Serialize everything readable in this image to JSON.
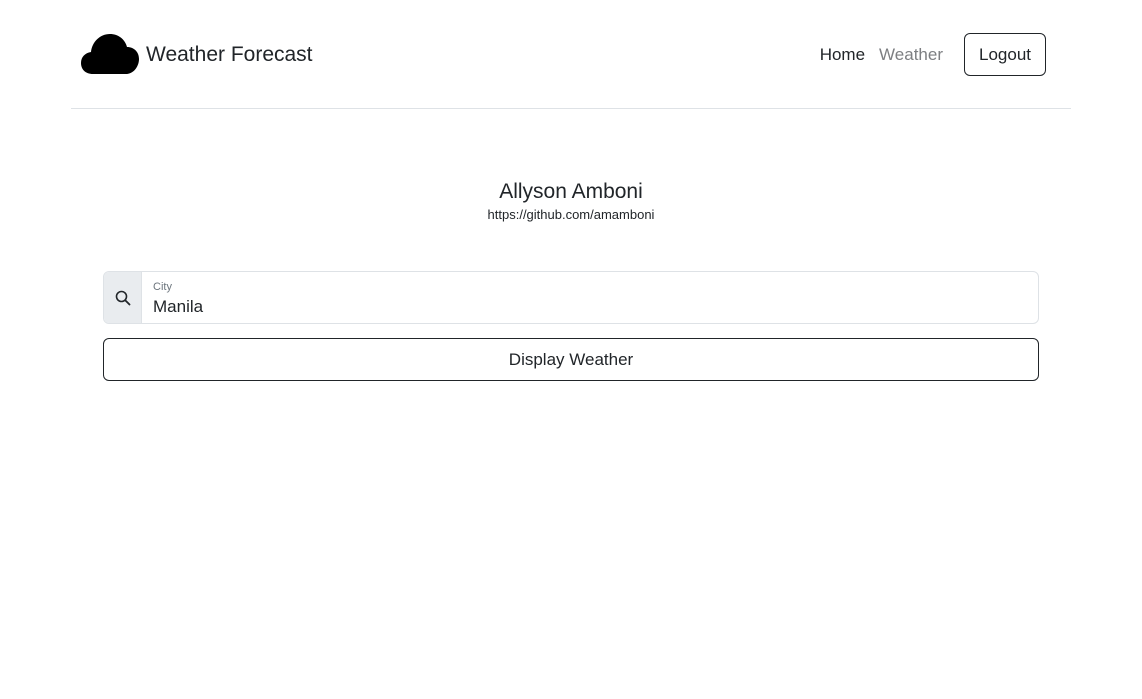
{
  "header": {
    "brand_title": "Weather Forecast",
    "brand_icon": "cloud-icon",
    "nav": {
      "home_label": "Home",
      "weather_label": "Weather",
      "logout_label": "Logout"
    }
  },
  "profile": {
    "name": "Allyson Amboni",
    "link": "https://github.com/amamboni"
  },
  "search": {
    "icon": "search-icon",
    "label": "City",
    "value": "Manila"
  },
  "actions": {
    "display_label": "Display Weather"
  },
  "colors": {
    "text": "#212529",
    "muted_nav": "#7d7f82",
    "border": "#dee2e6",
    "addon_bg": "#e9ecef"
  }
}
